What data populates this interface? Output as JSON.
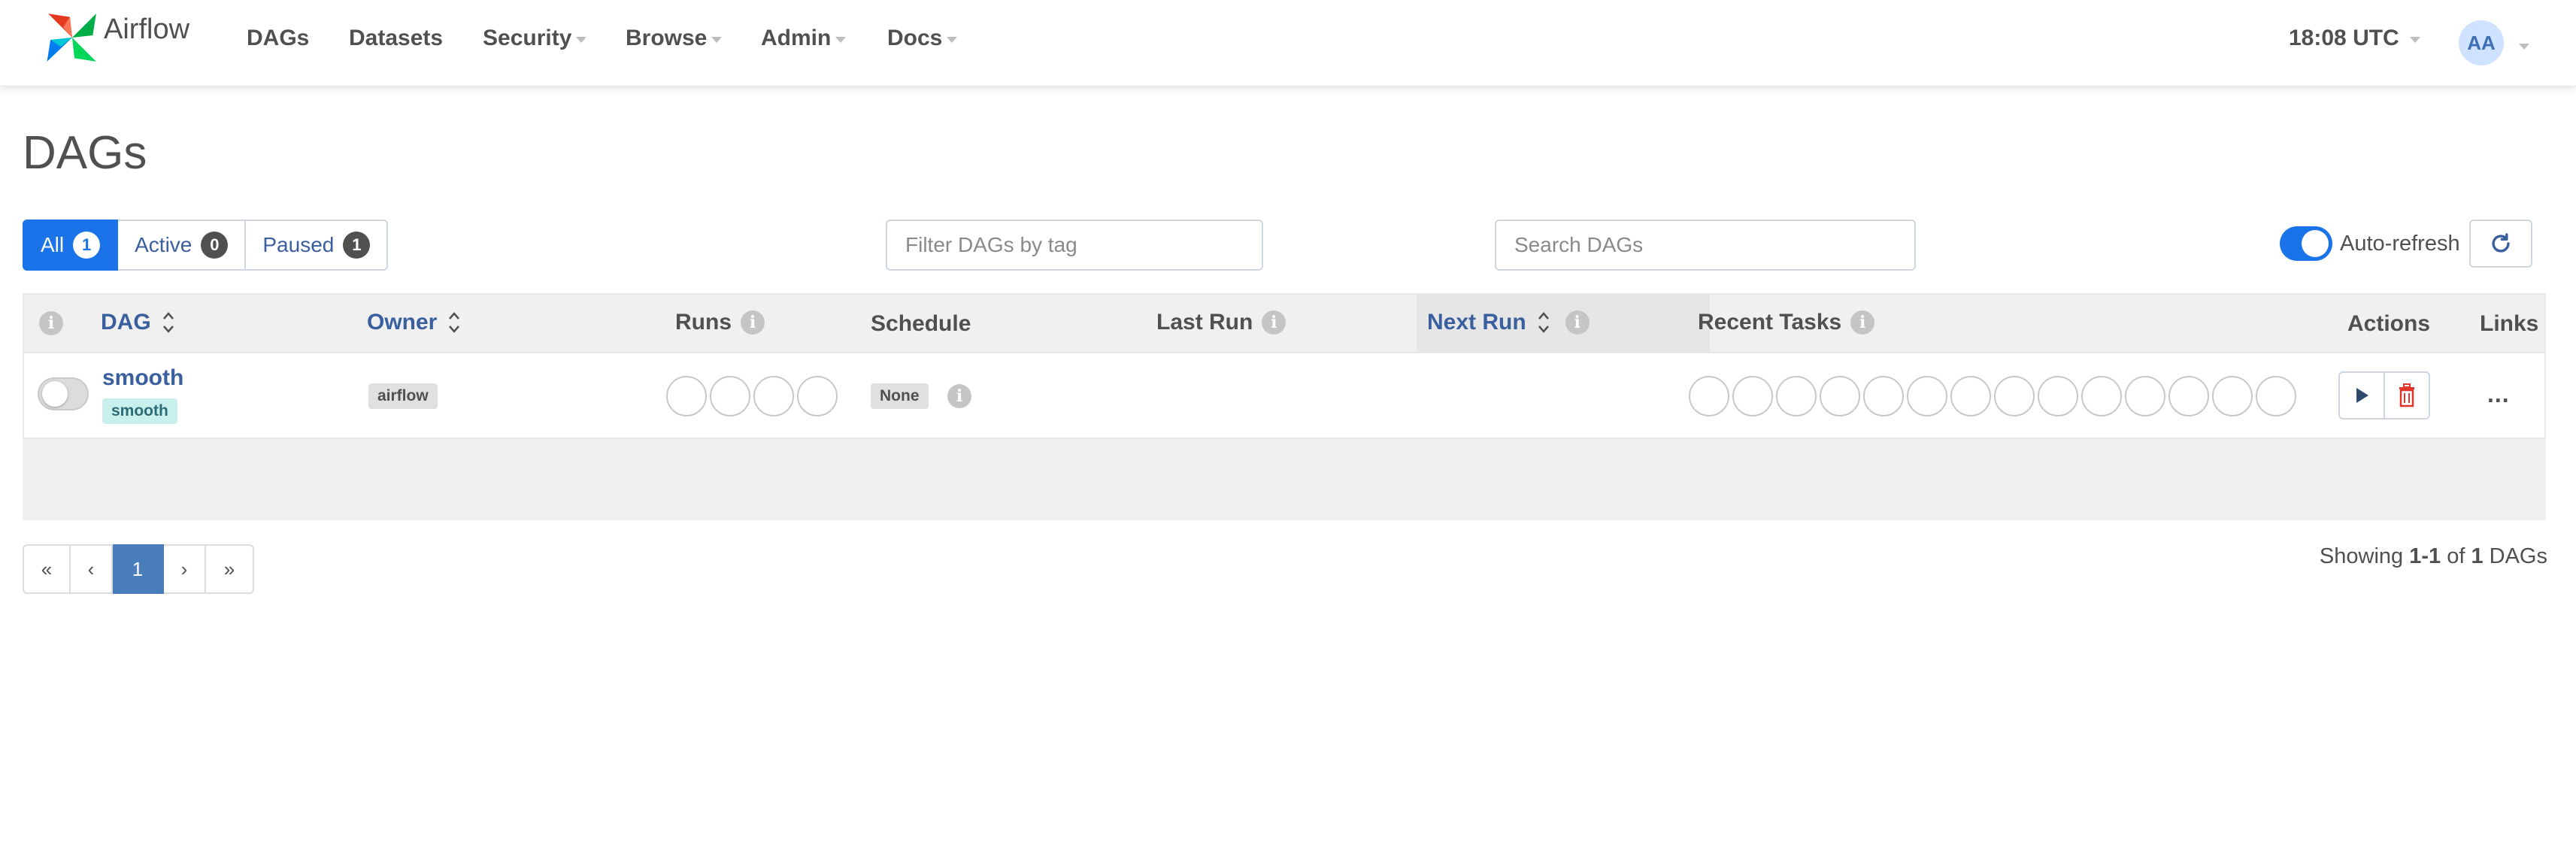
{
  "navbar": {
    "brand": "Airflow",
    "items": [
      {
        "label": "DAGs",
        "dropdown": false
      },
      {
        "label": "Datasets",
        "dropdown": false
      },
      {
        "label": "Security",
        "dropdown": true
      },
      {
        "label": "Browse",
        "dropdown": true
      },
      {
        "label": "Admin",
        "dropdown": true
      },
      {
        "label": "Docs",
        "dropdown": true
      }
    ],
    "time": "18:08 UTC",
    "avatar_initials": "AA"
  },
  "page": {
    "title": "DAGs"
  },
  "filters": {
    "status_buttons": [
      {
        "label": "All",
        "count": "1",
        "active": true
      },
      {
        "label": "Active",
        "count": "0",
        "active": false
      },
      {
        "label": "Paused",
        "count": "1",
        "active": false
      }
    ],
    "tag_placeholder": "Filter DAGs by tag",
    "search_placeholder": "Search DAGs",
    "autorefresh_label": "Auto-refresh"
  },
  "table": {
    "headers": {
      "dag": "DAG",
      "owner": "Owner",
      "runs": "Runs",
      "schedule": "Schedule",
      "last_run": "Last Run",
      "next_run": "Next Run",
      "recent_tasks": "Recent Tasks",
      "actions": "Actions",
      "links": "Links"
    },
    "rows": [
      {
        "dag_id": "smooth",
        "tag": "smooth",
        "owner": "airflow",
        "schedule": "None",
        "runs_circles": 4,
        "task_circles": 14,
        "paused": true,
        "links_label": "..."
      }
    ]
  },
  "pagination": {
    "first": "«",
    "prev": "‹",
    "current": "1",
    "next": "›",
    "last": "»"
  },
  "showing": {
    "prefix": "Showing ",
    "range": "1-1",
    "of": " of ",
    "total": "1",
    "suffix": " DAGs"
  },
  "colors": {
    "accent": "#1a73e8",
    "link": "#3a5f9f",
    "text": "#51504f",
    "delete_red": "#e0352b",
    "tag_bg": "#c8f0ec"
  }
}
